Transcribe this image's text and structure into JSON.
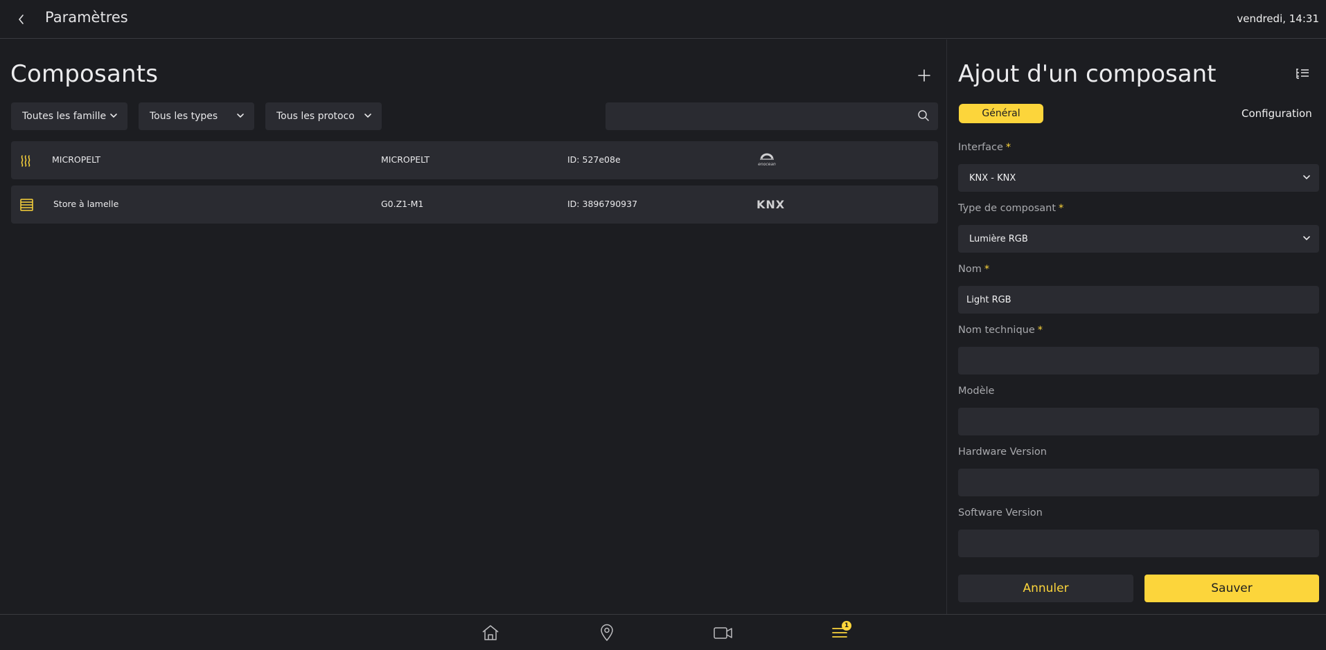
{
  "header": {
    "title": "Paramètres",
    "datetime": "vendredi, 14:31"
  },
  "components": {
    "title": "Composants",
    "filters": [
      {
        "label": "Toutes les famille"
      },
      {
        "label": "Tous les types"
      },
      {
        "label": "Tous les protocoles"
      }
    ],
    "search": {
      "placeholder": "",
      "value": ""
    },
    "rows": [
      {
        "icon": "heater-icon",
        "name": "MICROPELT",
        "model": "MICROPELT",
        "id": "ID: 527e08e",
        "protocol_logo": "enocean-logo",
        "logo_text": "enocean"
      },
      {
        "icon": "blind-icon",
        "name": "Store à lamelle",
        "model": "G0.Z1-M1",
        "id": "ID: 3896790937",
        "protocol_logo": "knx-logo",
        "logo_text": "KNX"
      }
    ]
  },
  "form": {
    "title": "Ajout d'un composant",
    "tabs": {
      "general": "Général",
      "configuration": "Configuration"
    },
    "fields": {
      "interface": {
        "label": "Interface",
        "required": "*",
        "value": "KNX - KNX"
      },
      "type": {
        "label": "Type de composant",
        "required": "*",
        "value": "Lumière RGB"
      },
      "name": {
        "label": "Nom",
        "required": "*",
        "value": "Light RGB"
      },
      "technical_name": {
        "label": "Nom technique",
        "required": "*",
        "value": ""
      },
      "model": {
        "label": "Modèle",
        "value": ""
      },
      "hardware_version": {
        "label": "Hardware Version",
        "value": ""
      },
      "software_version": {
        "label": "Software Version",
        "value": ""
      }
    },
    "buttons": {
      "cancel": "Annuler",
      "save": "Sauver"
    }
  },
  "nav": {
    "items": [
      "home-icon",
      "location-icon",
      "camera-icon",
      "menu-icon"
    ],
    "menu_badge": "1"
  },
  "colors": {
    "background": "#1c1d21",
    "surface": "#2a2b31",
    "accent": "#fcd53b",
    "text": "#e9e9ea",
    "muted": "#a9aaae"
  }
}
